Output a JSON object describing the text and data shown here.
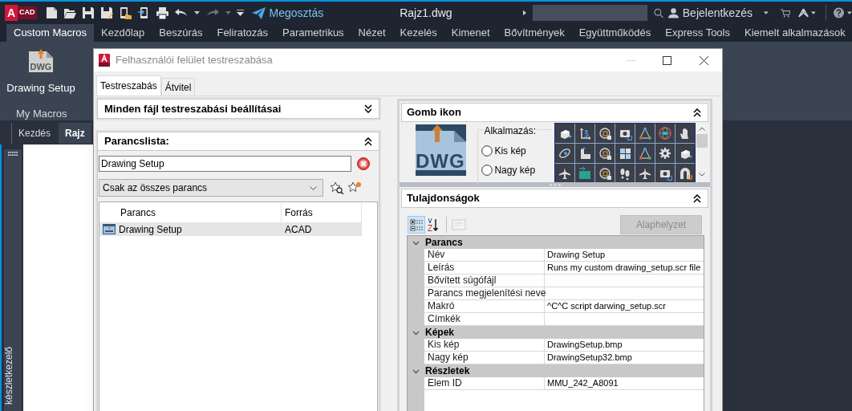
{
  "app_bar": {
    "logo_letter": "A",
    "logo_text": "CAD",
    "share": "Megosztás",
    "document_title": "Rajz1.dwg",
    "sign_in": "Bejelentkezés"
  },
  "ribbon_tabs": [
    {
      "label": "Custom Macros",
      "selected": true
    },
    {
      "label": "Kezdőlap",
      "selected": false
    },
    {
      "label": "Beszúrás",
      "selected": false
    },
    {
      "label": "Feliratozás",
      "selected": false
    },
    {
      "label": "Parametrikus",
      "selected": false
    },
    {
      "label": "Nézet",
      "selected": false
    },
    {
      "label": "Kezelés",
      "selected": false
    },
    {
      "label": "Kimenet",
      "selected": false
    },
    {
      "label": "Bővítmények",
      "selected": false
    },
    {
      "label": "Együttműködés",
      "selected": false
    },
    {
      "label": "Express Tools",
      "selected": false
    },
    {
      "label": "Kiemelt alkalmazások",
      "selected": false
    }
  ],
  "ribbon_panel": {
    "button_label": "Drawing Setup",
    "button_icon_text": "DWG",
    "panel_title": "My Macros"
  },
  "doc_tabs": [
    {
      "label": "Kezdés",
      "selected": false
    },
    {
      "label": "Rajz",
      "selected": true
    }
  ],
  "palette_label": "készletkezelő",
  "dialog": {
    "title": "Felhasználói felület testreszabása",
    "tabs": [
      {
        "label": "Testreszabás",
        "selected": true
      },
      {
        "label": "Átvitel",
        "selected": false
      }
    ],
    "files_header": "Minden fájl testreszabási beállításai",
    "command_list": {
      "header": "Parancslista:",
      "search_value": "Drawing Setup",
      "filter": "Csak az összes parancs",
      "columns": [
        "Parancs",
        "Forrás"
      ],
      "rows": [
        {
          "name": "Drawing Setup",
          "source": "ACAD",
          "selected": true
        }
      ]
    },
    "button_image": {
      "header": "Gomb ikon",
      "preview_text": "DWG",
      "apply_label": "Alkalmazás:",
      "options": [
        {
          "label": "Kis kép",
          "selected": false
        },
        {
          "label": "Nagy kép",
          "selected": false
        }
      ]
    },
    "properties": {
      "header": "Tulajdonságok",
      "reset_button": {
        "label": "Alaphelyzet",
        "disabled": true
      },
      "toolbar": [
        {
          "kind": "categorized",
          "selected": true,
          "disabled": false
        },
        {
          "kind": "alphabetical",
          "selected": false,
          "disabled": false
        },
        {
          "kind": "pages",
          "selected": false,
          "disabled": true
        }
      ],
      "categories": [
        {
          "name": "Parancs",
          "expanded": true,
          "rows": [
            {
              "name": "Név",
              "value": "Drawing Setup"
            },
            {
              "name": "Leírás",
              "value": "Runs my custom drawing_setup.scr file"
            },
            {
              "name": "Bővített súgófájl"
            },
            {
              "name": "Parancs megjelenítési neve"
            },
            {
              "name": "Makró",
              "value": "^C^C script darwing_setup.scr"
            },
            {
              "name": "Címkék"
            }
          ]
        },
        {
          "name": "Képek",
          "expanded": true,
          "rows": [
            {
              "name": "Kis kép",
              "value": "DrawingSetup.bmp"
            },
            {
              "name": "Nagy kép",
              "value": "DrawingSetup32.bmp"
            }
          ]
        },
        {
          "name": "Részletek",
          "expanded": true,
          "rows": [
            {
              "name": "Elem ID",
              "value": "MMU_242_A8091"
            }
          ]
        }
      ]
    }
  }
}
